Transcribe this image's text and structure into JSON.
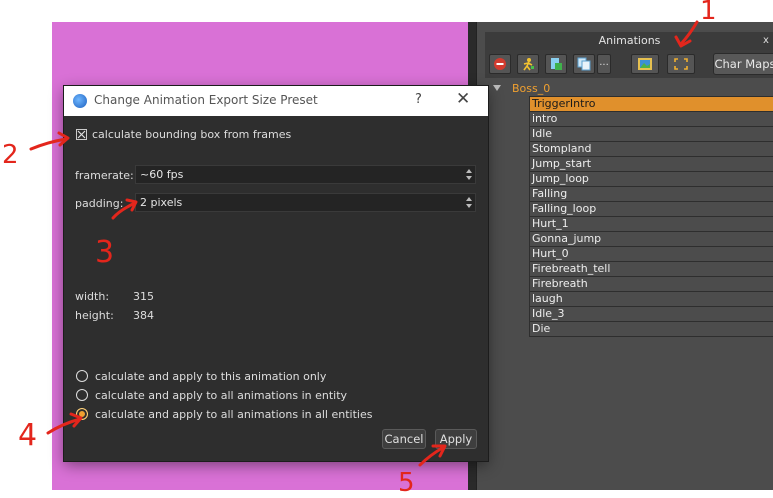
{
  "animations_panel": {
    "title": "Animations",
    "close_glyph": "x",
    "toolbar": {
      "icons": [
        "remove-icon",
        "walking-figure-icon",
        "export-icon",
        "duplicate-icon",
        "more-icon",
        "frame-image-icon",
        "bounding-box-icon"
      ],
      "more_label": "...",
      "char_maps_label": "Char Maps"
    },
    "tree": {
      "root": "Boss_0",
      "items": [
        "TriggerIntro",
        "intro",
        "Idle",
        "Stompland",
        "Jump_start",
        "Jump_loop",
        "Falling",
        "Falling_loop",
        "Hurt_1",
        "Gonna_jump",
        "Hurt_0",
        "Firebreath_tell",
        "Firebreath",
        "laugh",
        "Idle_3",
        "Die"
      ],
      "selected": "TriggerIntro"
    }
  },
  "dialog": {
    "title": "Change Animation Export Size Preset",
    "help_label": "?",
    "close_label": "✕",
    "checkbox_label": "calculate bounding box from frames",
    "checkbox_checked": true,
    "framerate_label": "framerate:",
    "framerate_value": "~60 fps",
    "padding_label": "padding:",
    "padding_value": "2 pixels",
    "width_label": "width:",
    "width_value": "315",
    "height_label": "height:",
    "height_value": "384",
    "radio_options": [
      "calculate and apply to this animation only",
      "calculate and apply to all animations in entity",
      "calculate and apply to all animations in all entities"
    ],
    "radio_selected_index": 2,
    "cancel_label": "Cancel",
    "apply_label": "Apply"
  },
  "annotations": {
    "n1": "1",
    "n2": "2",
    "n3": "3",
    "n4": "4",
    "n5": "5",
    "color": "#e3261c"
  },
  "colors": {
    "canvas": "#d971d6",
    "selection": "#e0902c",
    "root_label": "#f0a030"
  }
}
